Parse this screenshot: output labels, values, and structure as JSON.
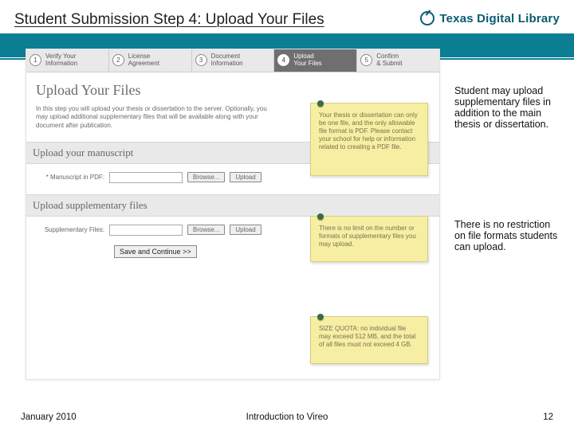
{
  "header": {
    "title": "Student Submission Step 4: Upload Your Files",
    "brand": "Texas Digital Library"
  },
  "steps": [
    {
      "num": "1",
      "label": "Verify Your\nInformation"
    },
    {
      "num": "2",
      "label": "License\nAgreement"
    },
    {
      "num": "3",
      "label": "Document\nInformation"
    },
    {
      "num": "4",
      "label": "Upload\nYour Files"
    },
    {
      "num": "5",
      "label": "Confirm\n& Submit"
    }
  ],
  "page": {
    "heading": "Upload Your Files",
    "intro": "In this step you will upload your thesis or dissertation to the server. Optionally, you may upload additional supplementary files that will be available along with your document after publication.",
    "section_manuscript": "Upload your manuscript",
    "manuscript_label": "* Manuscript in PDF:",
    "browse": "Browse...",
    "upload": "Upload",
    "section_supp": "Upload supplementary files",
    "supp_label": "Supplementary Files:",
    "save": "Save and Continue >>"
  },
  "notes": {
    "n1": "Your thesis or dissertation can only be one file, and the only allowable file format is PDF. Please contact your school for help or information related to creating a PDF file.",
    "n2": "There is no limit on the number or formats of supplementary files you may upload.",
    "n3": "SIZE QUOTA: no individual file may exceed 512 MB, and the total of all files must not exceed 4 GB."
  },
  "callouts": {
    "c1": "Student may upload supplementary files in addition to the main thesis or dissertation.",
    "c2": "There is no restriction on file formats students can upload."
  },
  "footer": {
    "date": "January 2010",
    "center": "Introduction to Vireo",
    "page": "12"
  }
}
